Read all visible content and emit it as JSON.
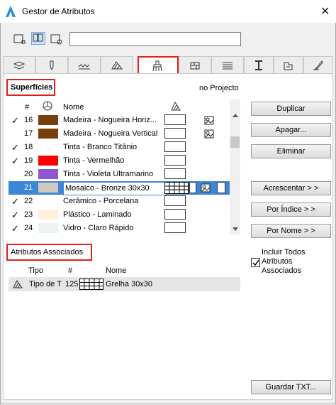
{
  "window": {
    "title": "Gestor de Atributos",
    "close_glyph": "✕"
  },
  "toolbar": {
    "search_value": ""
  },
  "tabs": [
    {
      "icon": "layers-icon"
    },
    {
      "icon": "pen-icon"
    },
    {
      "icon": "line-type-icon"
    },
    {
      "icon": "fill-icon"
    },
    {
      "icon": "surface-icon",
      "active": true
    },
    {
      "icon": "building-material-icon"
    },
    {
      "icon": "composite-icon"
    },
    {
      "icon": "profile-icon"
    },
    {
      "icon": "zone-icon"
    },
    {
      "icon": "markup-style-icon"
    }
  ],
  "surfaces": {
    "section_label": "Superfícies",
    "project_label": "no Projecto",
    "columns": {
      "number": "#",
      "name": "Nome"
    },
    "rows": [
      {
        "check": "✓",
        "num": "16",
        "color": "#7a3d0c",
        "name": "Madeira - Nogueira Horiz...",
        "fill": false,
        "texture": true
      },
      {
        "check": "",
        "num": "17",
        "color": "#7a3d0c",
        "name": "Madeira - Nogueira Vertical",
        "fill": false,
        "texture": true
      },
      {
        "check": "✓",
        "num": "18",
        "color": "#ffffff",
        "name": "Tinta - Branco Titânio",
        "fill": false,
        "texture": false
      },
      {
        "check": "✓",
        "num": "19",
        "color": "#ff0000",
        "name": "Tinta - Vermelhão",
        "fill": false,
        "texture": false
      },
      {
        "check": "",
        "num": "20",
        "color": "#8e56d0",
        "name": "Tinta - Violeta Ultramarino",
        "fill": false,
        "texture": false
      },
      {
        "check": "",
        "num": "21",
        "color": "#cfc8c0",
        "name": "Mosaico - Bronze 30x30",
        "fill": true,
        "texture": true,
        "selected": true
      },
      {
        "check": "✓",
        "num": "22",
        "color": "#ffffff",
        "name": "Cerâmico - Porcelana",
        "fill": false,
        "texture": false
      },
      {
        "check": "✓",
        "num": "23",
        "color": "#fdf0dc",
        "name": "Plástico - Laminado",
        "fill": false,
        "texture": false
      },
      {
        "check": "✓",
        "num": "24",
        "color": "#edf3ef",
        "name": "Vidro - Claro Rápido",
        "fill": false,
        "texture": false
      }
    ]
  },
  "buttons": {
    "duplicate": "Duplicar",
    "delete": "Apagar...",
    "eliminate": "Eliminar",
    "add": "Acrescentar > >",
    "by_index": "Por Índice > >",
    "by_name": "Por Nome > >",
    "save_txt": "Guardar TXT..."
  },
  "include_all": {
    "checked": true,
    "label": "Incluir Todos Atributos Associados"
  },
  "associated": {
    "section_label": "Atributos Associados",
    "columns": {
      "type": "Tipo",
      "number": "#",
      "name": "Nome"
    },
    "rows": [
      {
        "type": "Tipo de T",
        "num": "125",
        "name": "Grelha 30x30"
      }
    ]
  }
}
